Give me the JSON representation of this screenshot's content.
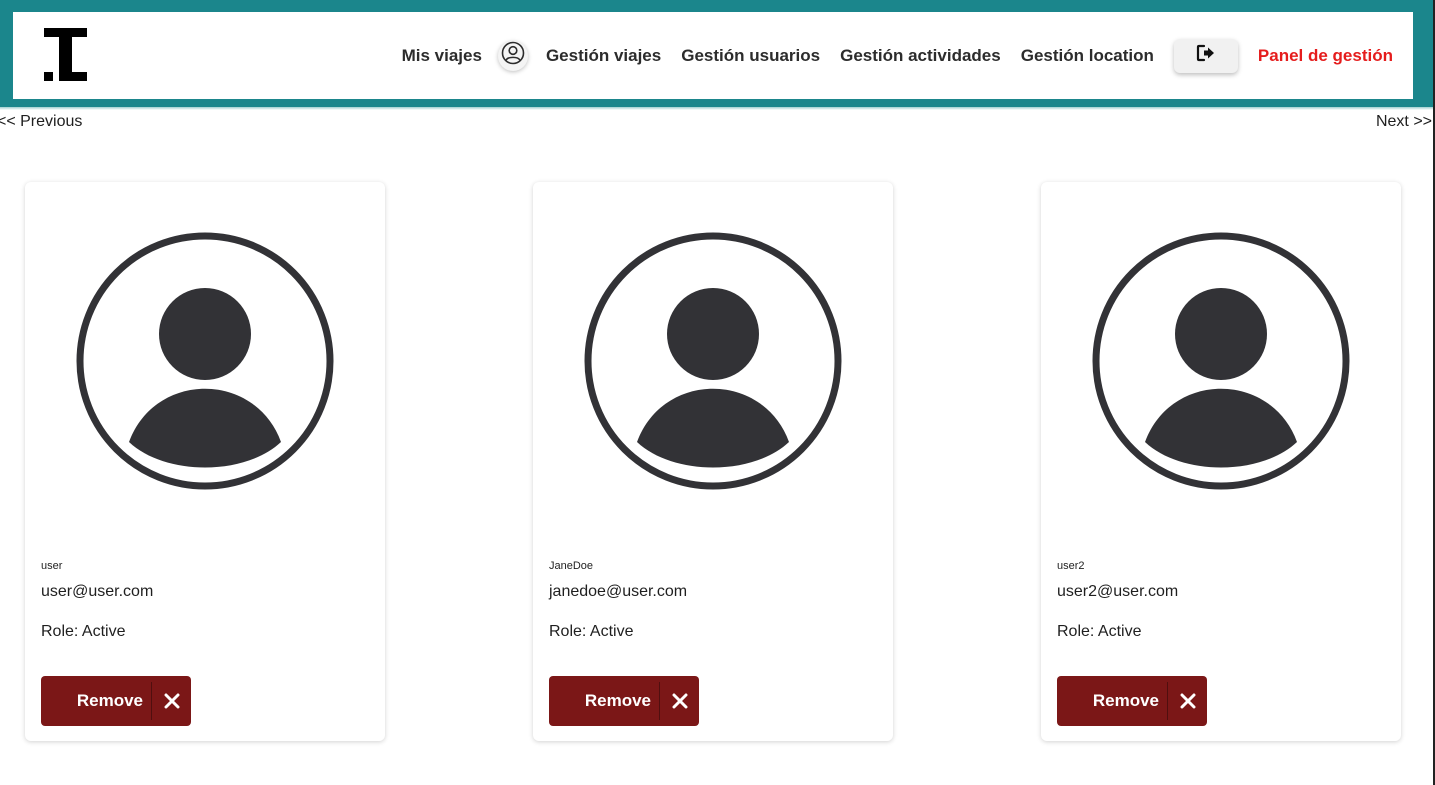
{
  "header": {
    "brand": "I",
    "nav": {
      "mis_viajes": "Mis viajes",
      "gestion_viajes": "Gestión viajes",
      "gestion_usuarios": "Gestión usuarios",
      "gestion_actividades": "Gestión actividades",
      "gestion_location": "Gestión location",
      "panel_gestion": "Panel de gestión"
    },
    "accent_color": "#e51d1d",
    "band_color": "#1b868c"
  },
  "pagination": {
    "previous": "<< Previous",
    "next": "Next >>"
  },
  "users": [
    {
      "username": "user",
      "email": "user@user.com",
      "role": "Role: Active",
      "remove_label": "Remove"
    },
    {
      "username": "JaneDoe",
      "email": "janedoe@user.com",
      "role": "Role: Active",
      "remove_label": "Remove"
    },
    {
      "username": "user2",
      "email": "user2@user.com",
      "role": "Role: Active",
      "remove_label": "Remove"
    }
  ],
  "colors": {
    "remove_button": "#7b1717",
    "avatar": "#323236"
  }
}
